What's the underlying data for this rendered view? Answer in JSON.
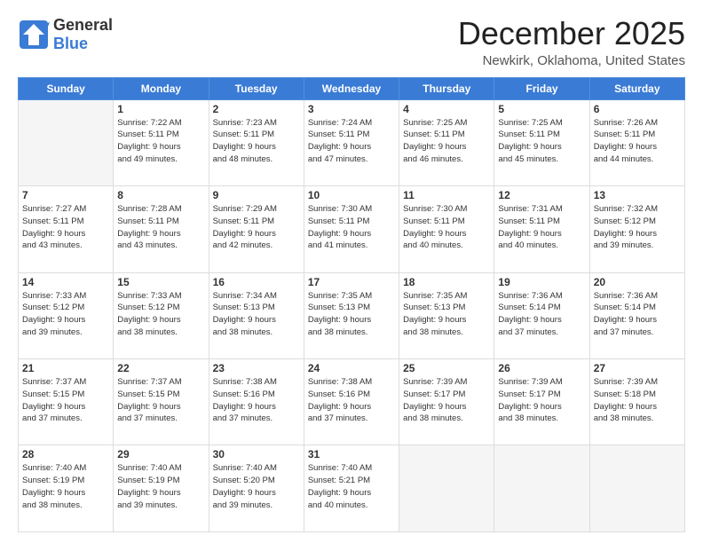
{
  "logo": {
    "general": "General",
    "blue": "Blue"
  },
  "header": {
    "title": "December 2025",
    "location": "Newkirk, Oklahoma, United States"
  },
  "days_of_week": [
    "Sunday",
    "Monday",
    "Tuesday",
    "Wednesday",
    "Thursday",
    "Friday",
    "Saturday"
  ],
  "weeks": [
    [
      {
        "day": "",
        "info": ""
      },
      {
        "day": "1",
        "info": "Sunrise: 7:22 AM\nSunset: 5:11 PM\nDaylight: 9 hours\nand 49 minutes."
      },
      {
        "day": "2",
        "info": "Sunrise: 7:23 AM\nSunset: 5:11 PM\nDaylight: 9 hours\nand 48 minutes."
      },
      {
        "day": "3",
        "info": "Sunrise: 7:24 AM\nSunset: 5:11 PM\nDaylight: 9 hours\nand 47 minutes."
      },
      {
        "day": "4",
        "info": "Sunrise: 7:25 AM\nSunset: 5:11 PM\nDaylight: 9 hours\nand 46 minutes."
      },
      {
        "day": "5",
        "info": "Sunrise: 7:25 AM\nSunset: 5:11 PM\nDaylight: 9 hours\nand 45 minutes."
      },
      {
        "day": "6",
        "info": "Sunrise: 7:26 AM\nSunset: 5:11 PM\nDaylight: 9 hours\nand 44 minutes."
      }
    ],
    [
      {
        "day": "7",
        "info": "Sunrise: 7:27 AM\nSunset: 5:11 PM\nDaylight: 9 hours\nand 43 minutes."
      },
      {
        "day": "8",
        "info": "Sunrise: 7:28 AM\nSunset: 5:11 PM\nDaylight: 9 hours\nand 43 minutes."
      },
      {
        "day": "9",
        "info": "Sunrise: 7:29 AM\nSunset: 5:11 PM\nDaylight: 9 hours\nand 42 minutes."
      },
      {
        "day": "10",
        "info": "Sunrise: 7:30 AM\nSunset: 5:11 PM\nDaylight: 9 hours\nand 41 minutes."
      },
      {
        "day": "11",
        "info": "Sunrise: 7:30 AM\nSunset: 5:11 PM\nDaylight: 9 hours\nand 40 minutes."
      },
      {
        "day": "12",
        "info": "Sunrise: 7:31 AM\nSunset: 5:11 PM\nDaylight: 9 hours\nand 40 minutes."
      },
      {
        "day": "13",
        "info": "Sunrise: 7:32 AM\nSunset: 5:12 PM\nDaylight: 9 hours\nand 39 minutes."
      }
    ],
    [
      {
        "day": "14",
        "info": "Sunrise: 7:33 AM\nSunset: 5:12 PM\nDaylight: 9 hours\nand 39 minutes."
      },
      {
        "day": "15",
        "info": "Sunrise: 7:33 AM\nSunset: 5:12 PM\nDaylight: 9 hours\nand 38 minutes."
      },
      {
        "day": "16",
        "info": "Sunrise: 7:34 AM\nSunset: 5:13 PM\nDaylight: 9 hours\nand 38 minutes."
      },
      {
        "day": "17",
        "info": "Sunrise: 7:35 AM\nSunset: 5:13 PM\nDaylight: 9 hours\nand 38 minutes."
      },
      {
        "day": "18",
        "info": "Sunrise: 7:35 AM\nSunset: 5:13 PM\nDaylight: 9 hours\nand 38 minutes."
      },
      {
        "day": "19",
        "info": "Sunrise: 7:36 AM\nSunset: 5:14 PM\nDaylight: 9 hours\nand 37 minutes."
      },
      {
        "day": "20",
        "info": "Sunrise: 7:36 AM\nSunset: 5:14 PM\nDaylight: 9 hours\nand 37 minutes."
      }
    ],
    [
      {
        "day": "21",
        "info": "Sunrise: 7:37 AM\nSunset: 5:15 PM\nDaylight: 9 hours\nand 37 minutes."
      },
      {
        "day": "22",
        "info": "Sunrise: 7:37 AM\nSunset: 5:15 PM\nDaylight: 9 hours\nand 37 minutes."
      },
      {
        "day": "23",
        "info": "Sunrise: 7:38 AM\nSunset: 5:16 PM\nDaylight: 9 hours\nand 37 minutes."
      },
      {
        "day": "24",
        "info": "Sunrise: 7:38 AM\nSunset: 5:16 PM\nDaylight: 9 hours\nand 37 minutes."
      },
      {
        "day": "25",
        "info": "Sunrise: 7:39 AM\nSunset: 5:17 PM\nDaylight: 9 hours\nand 38 minutes."
      },
      {
        "day": "26",
        "info": "Sunrise: 7:39 AM\nSunset: 5:17 PM\nDaylight: 9 hours\nand 38 minutes."
      },
      {
        "day": "27",
        "info": "Sunrise: 7:39 AM\nSunset: 5:18 PM\nDaylight: 9 hours\nand 38 minutes."
      }
    ],
    [
      {
        "day": "28",
        "info": "Sunrise: 7:40 AM\nSunset: 5:19 PM\nDaylight: 9 hours\nand 38 minutes."
      },
      {
        "day": "29",
        "info": "Sunrise: 7:40 AM\nSunset: 5:19 PM\nDaylight: 9 hours\nand 39 minutes."
      },
      {
        "day": "30",
        "info": "Sunrise: 7:40 AM\nSunset: 5:20 PM\nDaylight: 9 hours\nand 39 minutes."
      },
      {
        "day": "31",
        "info": "Sunrise: 7:40 AM\nSunset: 5:21 PM\nDaylight: 9 hours\nand 40 minutes."
      },
      {
        "day": "",
        "info": ""
      },
      {
        "day": "",
        "info": ""
      },
      {
        "day": "",
        "info": ""
      }
    ]
  ]
}
